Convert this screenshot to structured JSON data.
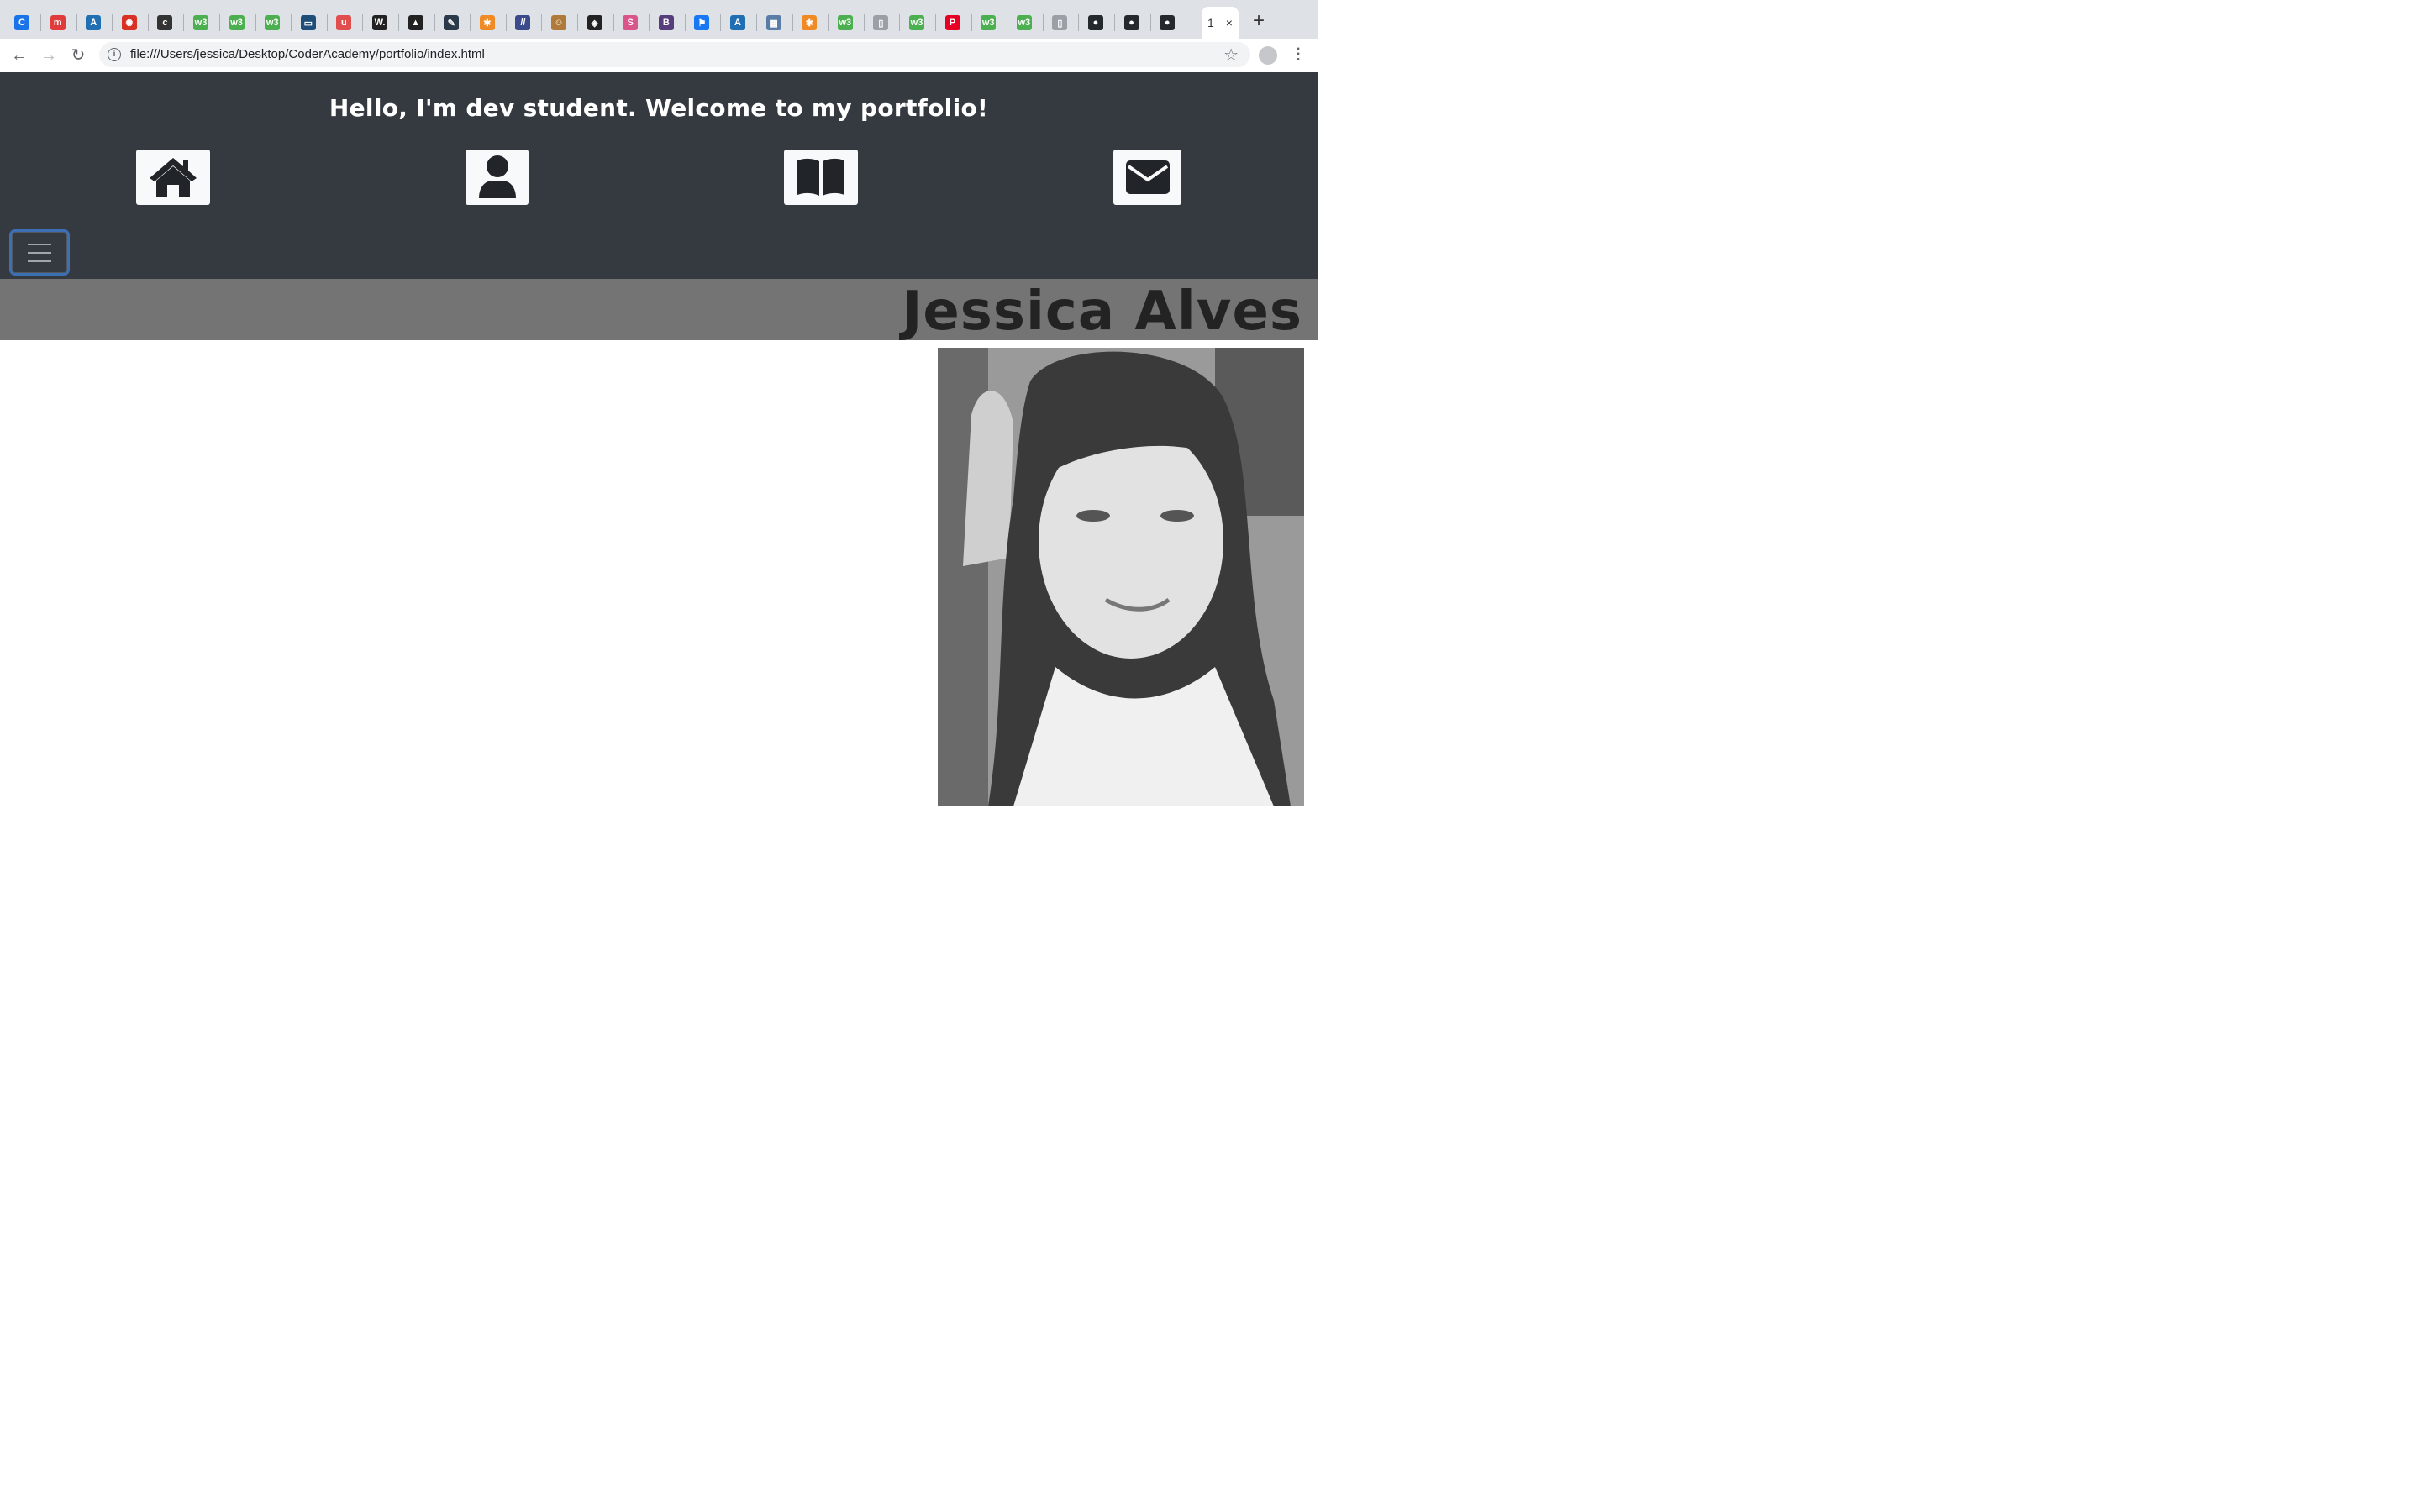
{
  "browser": {
    "tabs": [
      {
        "icon": "chrome-icon",
        "color": "#1a73e8",
        "glyph": "C"
      },
      {
        "icon": "m-icon",
        "color": "#e03c3c",
        "glyph": "m"
      },
      {
        "icon": "a-icon",
        "color": "#1f6fb2",
        "glyph": "A"
      },
      {
        "icon": "gear-red-icon",
        "color": "#d93025",
        "glyph": "✺"
      },
      {
        "icon": "c-bracket-icon",
        "color": "#333333",
        "glyph": "c"
      },
      {
        "icon": "w3-icon",
        "color": "#4caf50",
        "glyph": "w3"
      },
      {
        "icon": "w3-icon",
        "color": "#4caf50",
        "glyph": "w3"
      },
      {
        "icon": "w3-icon",
        "color": "#4caf50",
        "glyph": "w3"
      },
      {
        "icon": "laptop-icon",
        "color": "#1f4e79",
        "glyph": "▭"
      },
      {
        "icon": "u-icon",
        "color": "#e04e4e",
        "glyph": "u"
      },
      {
        "icon": "w-dot-icon",
        "color": "#222222",
        "glyph": "W."
      },
      {
        "icon": "cap-icon",
        "color": "#222222",
        "glyph": "▲"
      },
      {
        "icon": "pen-icon",
        "color": "#2b3a4a",
        "glyph": "✎"
      },
      {
        "icon": "asterisk-icon",
        "color": "#f08a24",
        "glyph": "✱"
      },
      {
        "icon": "slashes-icon",
        "color": "#3b4a8a",
        "glyph": "//"
      },
      {
        "icon": "figure-icon",
        "color": "#b07a3a",
        "glyph": "☺"
      },
      {
        "icon": "codepen-icon",
        "color": "#222222",
        "glyph": "◈"
      },
      {
        "icon": "s-icon",
        "color": "#d9558a",
        "glyph": "S"
      },
      {
        "icon": "bootstrap-icon",
        "color": "#563d7c",
        "glyph": "B"
      },
      {
        "icon": "flag-icon",
        "color": "#1877f2",
        "glyph": "⚑"
      },
      {
        "icon": "a-icon",
        "color": "#1f6fb2",
        "glyph": "A"
      },
      {
        "icon": "grid-icon",
        "color": "#5a7da8",
        "glyph": "▦"
      },
      {
        "icon": "asterisk-icon",
        "color": "#f08a24",
        "glyph": "✱"
      },
      {
        "icon": "w3-icon",
        "color": "#4caf50",
        "glyph": "w3"
      },
      {
        "icon": "document-icon",
        "color": "#9aa0a6",
        "glyph": "▯"
      },
      {
        "icon": "w3-icon",
        "color": "#4caf50",
        "glyph": "w3"
      },
      {
        "icon": "pinterest-icon",
        "color": "#e60023",
        "glyph": "P"
      },
      {
        "icon": "w3-icon",
        "color": "#4caf50",
        "glyph": "w3"
      },
      {
        "icon": "w3-icon",
        "color": "#4caf50",
        "glyph": "w3"
      },
      {
        "icon": "document-icon",
        "color": "#9aa0a6",
        "glyph": "▯"
      },
      {
        "icon": "github-icon",
        "color": "#24292e",
        "glyph": "●"
      },
      {
        "icon": "github-icon",
        "color": "#24292e",
        "glyph": "●"
      },
      {
        "icon": "github-icon",
        "color": "#24292e",
        "glyph": "●"
      }
    ],
    "active_tab_label": "1",
    "close_glyph": "×",
    "new_tab_glyph": "+",
    "back_glyph": "←",
    "forward_glyph": "→",
    "reload_glyph": "↻",
    "info_glyph": "i",
    "url": "file:///Users/jessica/Desktop/CoderAcademy/portfolio/index.html",
    "star_glyph": "☆",
    "menu_glyph": "⋮"
  },
  "page": {
    "greeting": "Hello, I'm dev student. Welcome to my portfolio!",
    "nav_icons": [
      {
        "name": "home-icon"
      },
      {
        "name": "user-icon"
      },
      {
        "name": "book-icon"
      },
      {
        "name": "envelope-icon"
      }
    ],
    "name": "Jessica Alves",
    "colors": {
      "header_bg": "#343a40",
      "name_bar_bg": "#757475",
      "icon_tile_bg": "#f8f9fa",
      "toggler_focus": "#3d6fb5"
    }
  }
}
